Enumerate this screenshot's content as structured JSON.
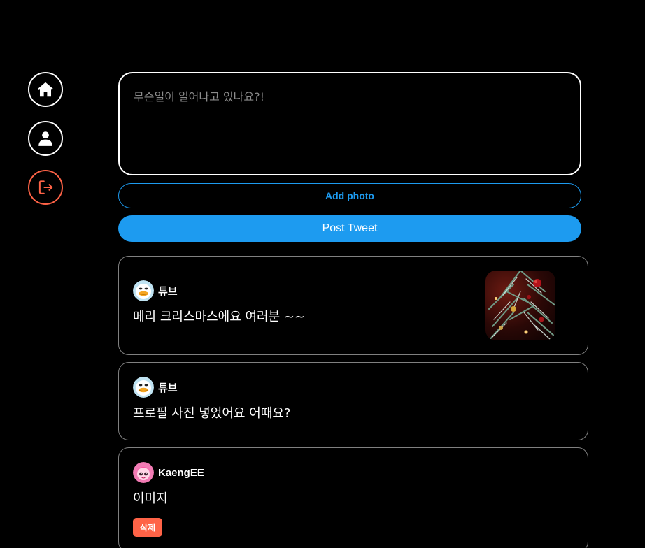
{
  "sidebar": {
    "items": [
      {
        "name": "home",
        "icon": "home-icon"
      },
      {
        "name": "profile",
        "icon": "user-icon"
      },
      {
        "name": "logout",
        "icon": "logout-icon",
        "color": "#ff6347"
      }
    ]
  },
  "compose": {
    "placeholder": "무슨일이 일어나고 있나요?!",
    "value": ""
  },
  "add_photo_label": "Add photo",
  "post_button_label": "Post Tweet",
  "colors": {
    "accent": "#1d9bf0",
    "danger": "#ff6347",
    "background": "#000000"
  },
  "tweets": [
    {
      "username": "튜브",
      "text": "메리 크리스마스에요 여러분 ~~",
      "avatar": "duck-avatar",
      "has_photo": true,
      "photo": "christmas-tree-photo"
    },
    {
      "username": "튜브",
      "text": "프로필 사진 넣었어요 어때요?",
      "avatar": "duck-avatar",
      "has_photo": false
    },
    {
      "username": "KaengEE",
      "text": "이미지",
      "avatar": "pink-character-avatar",
      "has_photo": false,
      "delete_label": "삭제"
    }
  ]
}
